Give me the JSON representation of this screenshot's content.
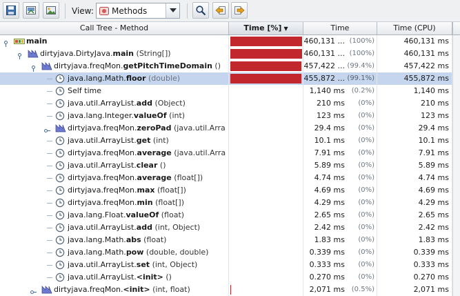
{
  "toolbar": {
    "view_label": "View:",
    "view_value": "Methods",
    "buttons": [
      {
        "name": "save-snapshot-icon"
      },
      {
        "name": "export-icon"
      },
      {
        "name": "save-image-icon"
      },
      {
        "name": "find-icon"
      },
      {
        "name": "find-previous-icon"
      },
      {
        "name": "find-next-icon"
      }
    ]
  },
  "columns": {
    "method": "Call Tree - Method",
    "time_pct": "Time [%]",
    "time": "Time",
    "time_cpu": "Time (CPU)"
  },
  "colors": {
    "bar": "#c1272d",
    "selection": "#c4d5ed"
  },
  "rows": [
    {
      "cls": "",
      "pkg": "",
      "method": "main",
      "args": "",
      "time": "460,131 ...",
      "pct": "(100%)",
      "cpu": "460,131 ms",
      "bar_fraction": 1.0,
      "icon": "thread-icon",
      "level": 0,
      "expanded": true
    },
    {
      "cls": "dirtyjava.DirtyJava.",
      "pkg": "",
      "method": "main",
      "args": " (String[])",
      "time": "460,131 ...",
      "pct": "(100%)",
      "cpu": "460,131 ms",
      "bar_fraction": 1.0,
      "icon": "method-icon",
      "level": 1,
      "expanded": true
    },
    {
      "cls": "dirtyjava.freqMon.",
      "pkg": "",
      "method": "getPitchTimeDomain",
      "args": " ()",
      "time": "457,422 ...",
      "pct": "(99.4%)",
      "cpu": "457,422 ms",
      "bar_fraction": 0.994,
      "icon": "method-icon",
      "level": 2,
      "expanded": true
    },
    {
      "cls": "java.lang.Math.",
      "pkg": "",
      "method": "floor",
      "args": " (double)",
      "time": "455,872 ...",
      "pct": "(99.1%)",
      "cpu": "455,872 ms",
      "bar_fraction": 0.991,
      "icon": "clock-icon",
      "level": 3,
      "selected": true
    },
    {
      "cls": "Self time",
      "pkg": "",
      "method": "",
      "args": "",
      "time": "1,140 ms",
      "pct": "(0.2%)",
      "cpu": "1,140 ms",
      "bar_fraction": 0,
      "icon": "clock-icon",
      "level": 3
    },
    {
      "cls": "java.util.ArrayList.",
      "pkg": "",
      "method": "add",
      "args": " (Object)",
      "time": "210 ms",
      "pct": "(0%)",
      "cpu": "210 ms",
      "bar_fraction": 0,
      "icon": "clock-icon",
      "level": 3
    },
    {
      "cls": "java.lang.Integer.",
      "pkg": "",
      "method": "valueOf",
      "args": " (int)",
      "time": "123 ms",
      "pct": "(0%)",
      "cpu": "123 ms",
      "bar_fraction": 0,
      "icon": "clock-icon",
      "level": 3
    },
    {
      "cls": "dirtyjava.freqMon.",
      "pkg": "",
      "method": "zeroPad",
      "args": " (java.util.Arra",
      "time": "29.4 ms",
      "pct": "(0%)",
      "cpu": "29.4 ms",
      "bar_fraction": 0,
      "icon": "method-icon",
      "level": 3,
      "collapsed": true
    },
    {
      "cls": "java.util.ArrayList.",
      "pkg": "",
      "method": "get",
      "args": " (int)",
      "time": "10.1 ms",
      "pct": "(0%)",
      "cpu": "10.1 ms",
      "bar_fraction": 0,
      "icon": "clock-icon",
      "level": 3
    },
    {
      "cls": "dirtyjava.freqMon.",
      "pkg": "",
      "method": "average",
      "args": " (java.util.Arra",
      "time": "7.91 ms",
      "pct": "(0%)",
      "cpu": "7.91 ms",
      "bar_fraction": 0,
      "icon": "clock-icon",
      "level": 3
    },
    {
      "cls": "java.util.ArrayList.",
      "pkg": "",
      "method": "clear",
      "args": " ()",
      "time": "5.89 ms",
      "pct": "(0%)",
      "cpu": "5.89 ms",
      "bar_fraction": 0,
      "icon": "clock-icon",
      "level": 3
    },
    {
      "cls": "dirtyjava.freqMon.",
      "pkg": "",
      "method": "average",
      "args": " (float[])",
      "time": "4.74 ms",
      "pct": "(0%)",
      "cpu": "4.74 ms",
      "bar_fraction": 0,
      "icon": "clock-icon",
      "level": 3
    },
    {
      "cls": "dirtyjava.freqMon.",
      "pkg": "",
      "method": "max",
      "args": " (float[])",
      "time": "4.69 ms",
      "pct": "(0%)",
      "cpu": "4.69 ms",
      "bar_fraction": 0,
      "icon": "clock-icon",
      "level": 3
    },
    {
      "cls": "dirtyjava.freqMon.",
      "pkg": "",
      "method": "min",
      "args": " (float[])",
      "time": "4.29 ms",
      "pct": "(0%)",
      "cpu": "4.29 ms",
      "bar_fraction": 0,
      "icon": "clock-icon",
      "level": 3
    },
    {
      "cls": "java.lang.Float.",
      "pkg": "",
      "method": "valueOf",
      "args": " (float)",
      "time": "2.65 ms",
      "pct": "(0%)",
      "cpu": "2.65 ms",
      "bar_fraction": 0,
      "icon": "clock-icon",
      "level": 3
    },
    {
      "cls": "java.util.ArrayList.",
      "pkg": "",
      "method": "add",
      "args": " (int, Object)",
      "time": "2.42 ms",
      "pct": "(0%)",
      "cpu": "2.42 ms",
      "bar_fraction": 0,
      "icon": "clock-icon",
      "level": 3
    },
    {
      "cls": "java.lang.Math.",
      "pkg": "",
      "method": "abs",
      "args": " (float)",
      "time": "1.83 ms",
      "pct": "(0%)",
      "cpu": "1.83 ms",
      "bar_fraction": 0,
      "icon": "clock-icon",
      "level": 3
    },
    {
      "cls": "java.lang.Math.",
      "pkg": "",
      "method": "pow",
      "args": " (double, double)",
      "time": "0.339 ms",
      "pct": "(0%)",
      "cpu": "0.339 ms",
      "bar_fraction": 0,
      "icon": "clock-icon",
      "level": 3
    },
    {
      "cls": "java.util.ArrayList.",
      "pkg": "",
      "method": "set",
      "args": " (int, Object)",
      "time": "0.333 ms",
      "pct": "(0%)",
      "cpu": "0.333 ms",
      "bar_fraction": 0,
      "icon": "clock-icon",
      "level": 3
    },
    {
      "cls": "java.util.ArrayList.",
      "pkg": "",
      "method": "<init>",
      "args": " ()",
      "time": "0.270 ms",
      "pct": "(0%)",
      "cpu": "0.270 ms",
      "bar_fraction": 0,
      "icon": "clock-icon",
      "level": 3
    },
    {
      "cls": "dirtyjava.freqMon.",
      "pkg": "",
      "method": "<init>",
      "args": " (int, float)",
      "time": "2,071 ms",
      "pct": "(0.5%)",
      "cpu": "2,071 ms",
      "bar_fraction": 0.005,
      "icon": "method-icon",
      "level": 2,
      "collapsed": true
    }
  ]
}
